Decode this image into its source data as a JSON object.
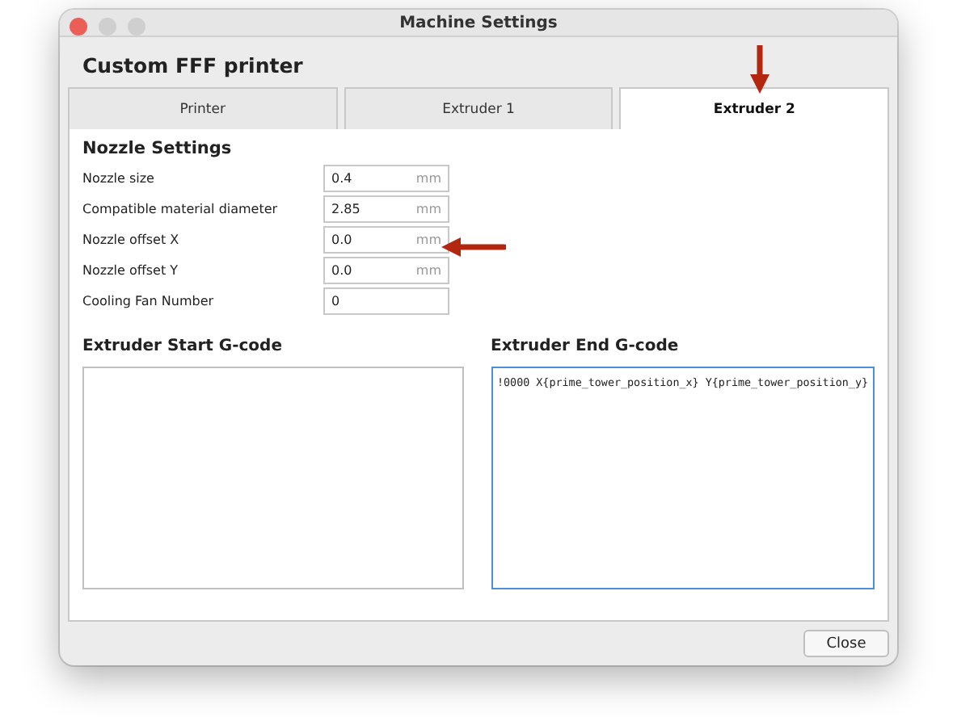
{
  "window": {
    "title": "Machine Settings"
  },
  "heading": "Custom FFF printer",
  "tabs": [
    {
      "label": "Printer",
      "selected": false
    },
    {
      "label": "Extruder 1",
      "selected": false
    },
    {
      "label": "Extruder 2",
      "selected": true
    }
  ],
  "nozzle_settings": {
    "title": "Nozzle Settings",
    "fields": [
      {
        "label": "Nozzle size",
        "value": "0.4",
        "unit": "mm"
      },
      {
        "label": "Compatible material diameter",
        "value": "2.85",
        "unit": "mm"
      },
      {
        "label": "Nozzle offset X",
        "value": "0.0",
        "unit": "mm"
      },
      {
        "label": "Nozzle offset Y",
        "value": "0.0",
        "unit": "mm"
      },
      {
        "label": "Cooling Fan Number",
        "value": "0"
      }
    ]
  },
  "start_gcode": {
    "title": "Extruder Start G-code",
    "focused": false
  },
  "end_gcode": {
    "title": "Extruder End G-code",
    "value": "!0000 X{prime_tower_position_x} Y{prime_tower_position_y}",
    "focused": true
  },
  "buttons": [
    "Close"
  ]
}
